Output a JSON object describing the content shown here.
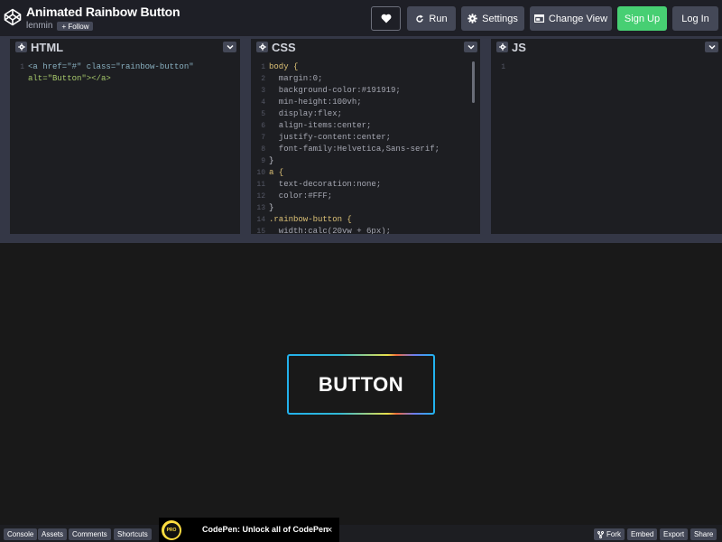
{
  "header": {
    "pen_title": "Animated Rainbow Button",
    "author": "lenmin",
    "follow_label": "+ Follow",
    "run_label": "Run",
    "settings_label": "Settings",
    "change_view_label": "Change View",
    "signup_label": "Sign Up",
    "login_label": "Log In"
  },
  "editors": {
    "html": {
      "title": "HTML",
      "lines": [
        {
          "num": "1",
          "text": "<a href=\"#\" class=\"rainbow-button\""
        },
        {
          "num": "",
          "text": "alt=\"Button\"></a>"
        }
      ]
    },
    "css": {
      "title": "CSS",
      "lines": [
        {
          "num": "1",
          "text": "body {"
        },
        {
          "num": "2",
          "text": "  margin:0;"
        },
        {
          "num": "3",
          "text": "  background-color:#191919;"
        },
        {
          "num": "4",
          "text": "  min-height:100vh;"
        },
        {
          "num": "5",
          "text": "  display:flex;"
        },
        {
          "num": "6",
          "text": "  align-items:center;"
        },
        {
          "num": "7",
          "text": "  justify-content:center;"
        },
        {
          "num": "8",
          "text": "  font-family:Helvetica,Sans-serif;"
        },
        {
          "num": "9",
          "text": "}"
        },
        {
          "num": "10",
          "text": "a {"
        },
        {
          "num": "11",
          "text": "  text-decoration:none;"
        },
        {
          "num": "12",
          "text": "  color:#FFF;"
        },
        {
          "num": "13",
          "text": "}"
        },
        {
          "num": "14",
          "text": ".rainbow-button {"
        },
        {
          "num": "15",
          "text": "  width:calc(20vw + 6px);"
        }
      ]
    },
    "js": {
      "title": "JS",
      "lines": [
        {
          "num": "1",
          "text": ""
        }
      ]
    }
  },
  "preview": {
    "button_label": "BUTTON",
    "colors": [
      "#22b1ec",
      "#31b8d6",
      "#e8e04a",
      "#f26c3b",
      "#6e7df0",
      "#1fb5ef"
    ]
  },
  "footer": {
    "console_label": "Console",
    "assets_label": "Assets",
    "comments_label": "Comments",
    "shortcuts_label": "Shortcuts",
    "ad_badge": "PRO",
    "ad_text": "CodePen: Unlock all of CodePen",
    "ad_close": "×",
    "fork_label": "Fork",
    "embed_label": "Embed",
    "export_label": "Export",
    "share_label": "Share"
  },
  "icons": [
    "codepen-logo-icon",
    "heart-icon",
    "run-icon",
    "gear-icon",
    "change-view-icon",
    "chevron-down-icon",
    "fork-icon",
    "close-icon"
  ],
  "brand_colors": {
    "signup": "#47cf73",
    "button_bg": "#444857",
    "header_bg": "#1e1f26",
    "preview_bg": "#191919"
  }
}
